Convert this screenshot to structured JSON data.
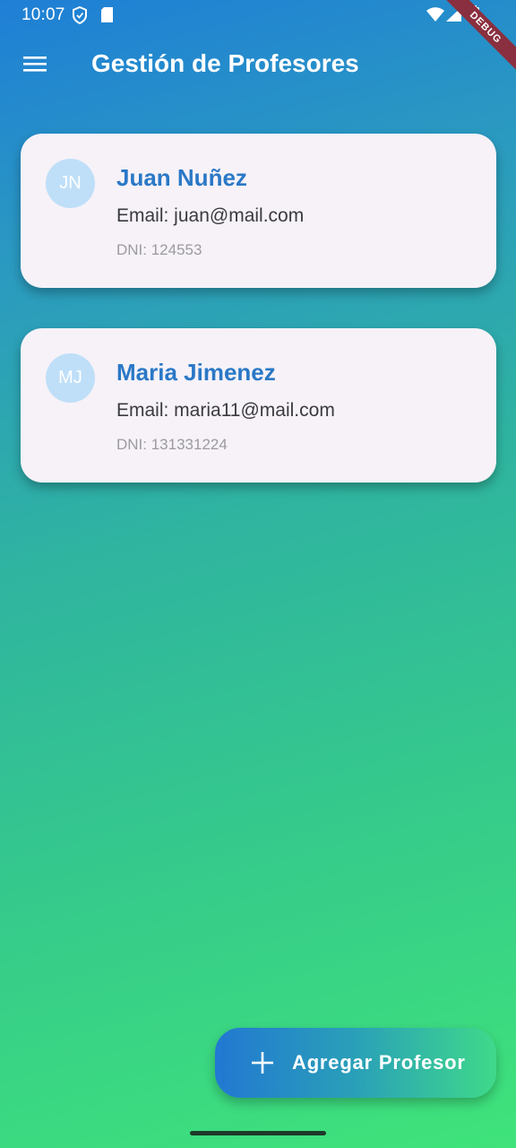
{
  "status_bar": {
    "time": "10:07",
    "icons": [
      "shield-icon",
      "sd-card-icon",
      "wifi-icon",
      "signal-icon",
      "battery-icon"
    ]
  },
  "debug_banner": "DEBUG",
  "app_bar": {
    "menu_icon": "menu-icon",
    "title": "Gestión de Profesores"
  },
  "professors": [
    {
      "initials": "JN",
      "name": "Juan Nuñez",
      "email": "Email: juan@mail.com",
      "dni": "DNI: 124553"
    },
    {
      "initials": "MJ",
      "name": "Maria Jimenez",
      "email": "Email: maria11@mail.com",
      "dni": "DNI: 131331224"
    }
  ],
  "fab": {
    "icon": "plus-icon",
    "label": "Agregar Profesor"
  },
  "colors": {
    "accent": "#2a78c6",
    "card_background": "#f6f2f8",
    "avatar_background": "#bfdff8",
    "gradient_top": "#1f7fd6",
    "gradient_bottom": "#3fe37a"
  }
}
